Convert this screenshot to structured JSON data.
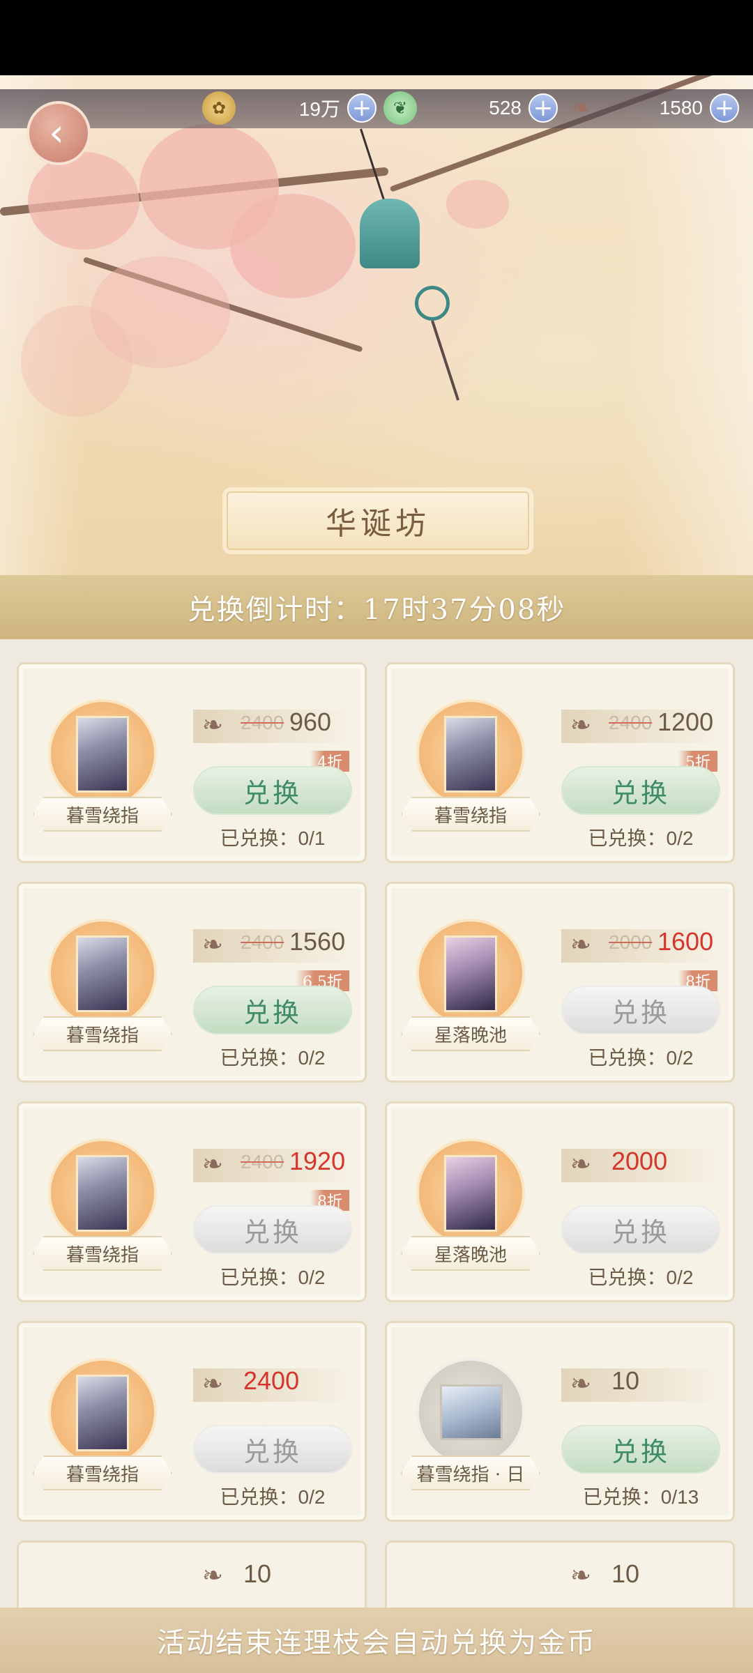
{
  "currencies": [
    {
      "icon": "paw-coin-icon",
      "value": "19万"
    },
    {
      "icon": "bird-gem-icon",
      "value": "528"
    },
    {
      "icon": "branch-token-icon",
      "value": "1580"
    }
  ],
  "banner": {
    "title": "华诞坊"
  },
  "countdown": {
    "text": "兑换倒计时：17时37分08秒"
  },
  "items": [
    {
      "name": "暮雪绕指",
      "price_old": "2400",
      "price_new": "960",
      "red": false,
      "discount": "4折",
      "button": "兑换",
      "enabled": true,
      "exchanged_label": "已兑换：",
      "exchanged": "0/1",
      "portrait": "a"
    },
    {
      "name": "暮雪绕指",
      "price_old": "2400",
      "price_new": "1200",
      "red": false,
      "discount": "5折",
      "button": "兑换",
      "enabled": true,
      "exchanged_label": "已兑换：",
      "exchanged": "0/2",
      "portrait": "a"
    },
    {
      "name": "暮雪绕指",
      "price_old": "2400",
      "price_new": "1560",
      "red": false,
      "discount": "6.5折",
      "button": "兑换",
      "enabled": true,
      "exchanged_label": "已兑换：",
      "exchanged": "0/2",
      "portrait": "a"
    },
    {
      "name": "星落晚池",
      "price_old": "2000",
      "price_new": "1600",
      "red": true,
      "discount": "8折",
      "button": "兑换",
      "enabled": false,
      "exchanged_label": "已兑换：",
      "exchanged": "0/2",
      "portrait": "b"
    },
    {
      "name": "暮雪绕指",
      "price_old": "2400",
      "price_new": "1920",
      "red": true,
      "discount": "8折",
      "button": "兑换",
      "enabled": false,
      "exchanged_label": "已兑换：",
      "exchanged": "0/2",
      "portrait": "a"
    },
    {
      "name": "星落晚池",
      "price_old": "",
      "price_new": "2000",
      "red": true,
      "discount": "",
      "button": "兑换",
      "enabled": false,
      "exchanged_label": "已兑换：",
      "exchanged": "0/2",
      "portrait": "b"
    },
    {
      "name": "暮雪绕指",
      "price_old": "",
      "price_new": "2400",
      "red": true,
      "discount": "",
      "button": "兑换",
      "enabled": false,
      "exchanged_label": "已兑换：",
      "exchanged": "0/2",
      "portrait": "a"
    },
    {
      "name": "暮雪绕指 · 日",
      "price_old": "",
      "price_new": "10",
      "red": false,
      "discount": "",
      "button": "兑换",
      "enabled": true,
      "exchanged_label": "已兑换：",
      "exchanged": "0/13",
      "portrait": "sq"
    }
  ],
  "partial_items": [
    {
      "price": "10"
    },
    {
      "price": "10"
    }
  ],
  "footer": {
    "notice": "活动结束连理枝会自动兑换为金币"
  }
}
